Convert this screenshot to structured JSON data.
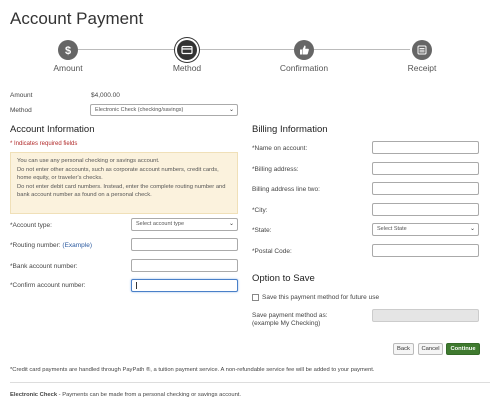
{
  "page": {
    "title": "Account Payment"
  },
  "stepper": {
    "steps": [
      {
        "label": "Amount",
        "icon": "dollar-icon",
        "state": "done"
      },
      {
        "label": "Method",
        "icon": "card-icon",
        "state": "active"
      },
      {
        "label": "Confirmation",
        "icon": "thumbs-up-icon",
        "state": "pending"
      },
      {
        "label": "Receipt",
        "icon": "list-icon",
        "state": "pending"
      }
    ]
  },
  "summary": {
    "amount_label": "Amount",
    "amount_value": "$4,000.00",
    "method_label": "Method",
    "method_value": "Electronic Check (checking/savings)"
  },
  "account_info": {
    "heading": "Account Information",
    "required_note": "* Indicates required fields",
    "notice": [
      "You can use any personal checking or savings account.",
      "Do not enter other accounts, such as corporate account numbers, credit cards, home equity, or traveler's checks.",
      "Do not enter debit card numbers. Instead, enter the complete routing number and bank account number as found on a personal check."
    ],
    "account_type_label": "*Account type:",
    "account_type_placeholder": "Select account type",
    "routing_label": "*Routing number:",
    "routing_example": "(Example)",
    "bank_account_label": "*Bank account number:",
    "confirm_account_label": "*Confirm account number:"
  },
  "billing_info": {
    "heading": "Billing Information",
    "name_label": "*Name on account:",
    "address_label": "*Billing address:",
    "address2_label": "Billing address line two:",
    "city_label": "*City:",
    "state_label": "*State:",
    "state_placeholder": "Select State",
    "postal_label": "*Postal Code:"
  },
  "option_to_save": {
    "heading": "Option to Save",
    "checkbox_label": "Save this payment method for future use",
    "save_as_label_line1": "Save payment method as:",
    "save_as_label_line2": "(example My Checking)"
  },
  "buttons": {
    "back": "Back",
    "cancel": "Cancel",
    "continue": "Continue"
  },
  "footnotes": {
    "credit_card": "*Credit card payments are handled through PayPath ®, a tuition payment service. A non-refundable service fee will be added to your payment.",
    "echeck_title": "Electronic Check",
    "echeck_text": " - Payments can be made from a personal checking or savings account."
  },
  "colors": {
    "primary_button": "#3f7a2f",
    "required": "#b12a2a",
    "notice_bg": "#fbf2dd",
    "link": "#2b5aa0"
  }
}
